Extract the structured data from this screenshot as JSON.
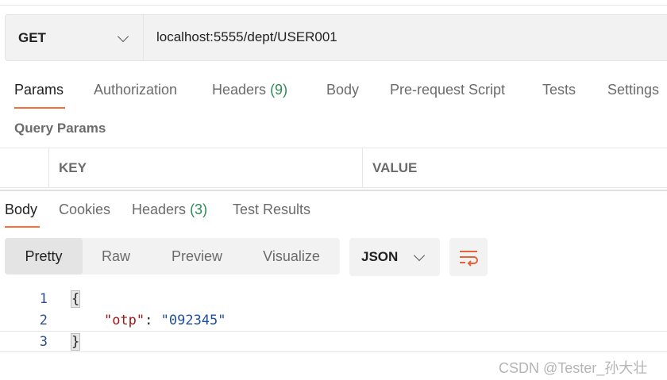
{
  "request": {
    "method": "GET",
    "url": "localhost:5555/dept/USER001"
  },
  "request_tabs": [
    {
      "label": "Params",
      "count": ""
    },
    {
      "label": "Authorization",
      "count": ""
    },
    {
      "label": "Headers",
      "count": "(9)"
    },
    {
      "label": "Body",
      "count": ""
    },
    {
      "label": "Pre-request Script",
      "count": ""
    },
    {
      "label": "Tests",
      "count": ""
    },
    {
      "label": "Settings",
      "count": ""
    }
  ],
  "query_params": {
    "title": "Query Params",
    "columns": [
      "KEY",
      "VALUE"
    ]
  },
  "response_tabs": [
    {
      "label": "Body",
      "count": ""
    },
    {
      "label": "Cookies",
      "count": ""
    },
    {
      "label": "Headers",
      "count": "(3)"
    },
    {
      "label": "Test Results",
      "count": ""
    }
  ],
  "view_modes": [
    "Pretty",
    "Raw",
    "Preview",
    "Visualize"
  ],
  "format": "JSON",
  "code": {
    "line_numbers": [
      "1",
      "2",
      "3"
    ],
    "open_brace": "{",
    "key": "\"otp\"",
    "colon": ": ",
    "value": "\"092345\"",
    "close_brace": "}"
  },
  "watermark": "CSDN @Tester_孙大壮",
  "colors": {
    "accent": "#ff6c37",
    "count_green": "#2e8b57",
    "json_key": "#a31515",
    "json_value": "#1f4fa0"
  }
}
